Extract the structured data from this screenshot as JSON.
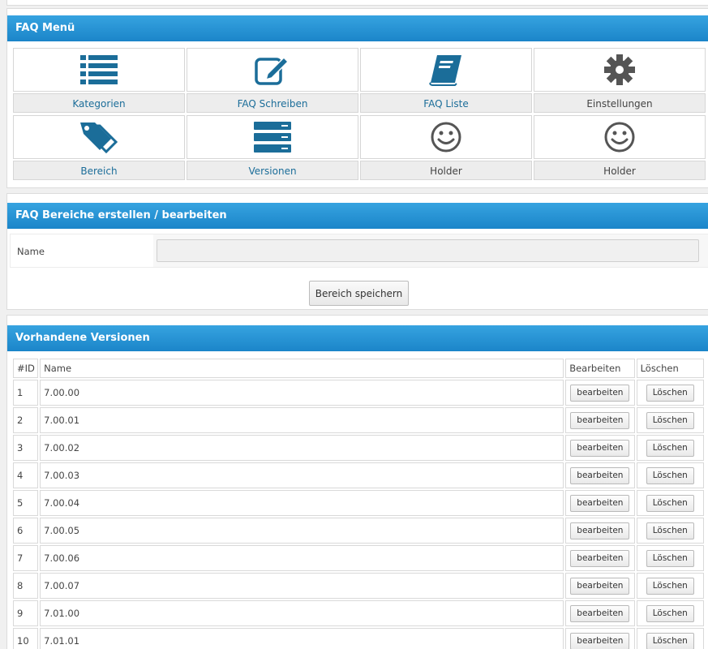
{
  "faq_menu": {
    "title": "FAQ Menü",
    "tiles": [
      {
        "label": "Kategorien",
        "icon": "list-icon",
        "style": "link"
      },
      {
        "label": "FAQ Schreiben",
        "icon": "edit-icon",
        "style": "link"
      },
      {
        "label": "FAQ Liste",
        "icon": "book-icon",
        "style": "link"
      },
      {
        "label": "Einstellungen",
        "icon": "gear-icon",
        "style": "plain"
      },
      {
        "label": "Bereich",
        "icon": "tags-icon",
        "style": "link"
      },
      {
        "label": "Versionen",
        "icon": "server-icon",
        "style": "link"
      },
      {
        "label": "Holder",
        "icon": "smiley-icon",
        "style": "plain"
      },
      {
        "label": "Holder",
        "icon": "smiley-icon",
        "style": "plain"
      }
    ]
  },
  "form": {
    "title": "FAQ Bereiche erstellen / bearbeiten",
    "name_label": "Name",
    "name_value": "",
    "save_label": "Bereich speichern"
  },
  "versions": {
    "title": "Vorhandene Versionen",
    "headers": {
      "id": "#ID",
      "name": "Name",
      "edit": "Bearbeiten",
      "delete": "Löschen"
    },
    "edit_label": "bearbeiten",
    "delete_label": "Löschen",
    "rows": [
      {
        "id": "1",
        "name": "7.00.00"
      },
      {
        "id": "2",
        "name": "7.00.01"
      },
      {
        "id": "3",
        "name": "7.00.02"
      },
      {
        "id": "4",
        "name": "7.00.03"
      },
      {
        "id": "5",
        "name": "7.00.04"
      },
      {
        "id": "6",
        "name": "7.00.05"
      },
      {
        "id": "7",
        "name": "7.00.06"
      },
      {
        "id": "8",
        "name": "7.00.07"
      },
      {
        "id": "9",
        "name": "7.01.00"
      },
      {
        "id": "10",
        "name": "7.01.01"
      }
    ]
  },
  "colors": {
    "accent": "#1b85c9",
    "icon_blue": "#1b6d99",
    "icon_gray": "#555555"
  }
}
